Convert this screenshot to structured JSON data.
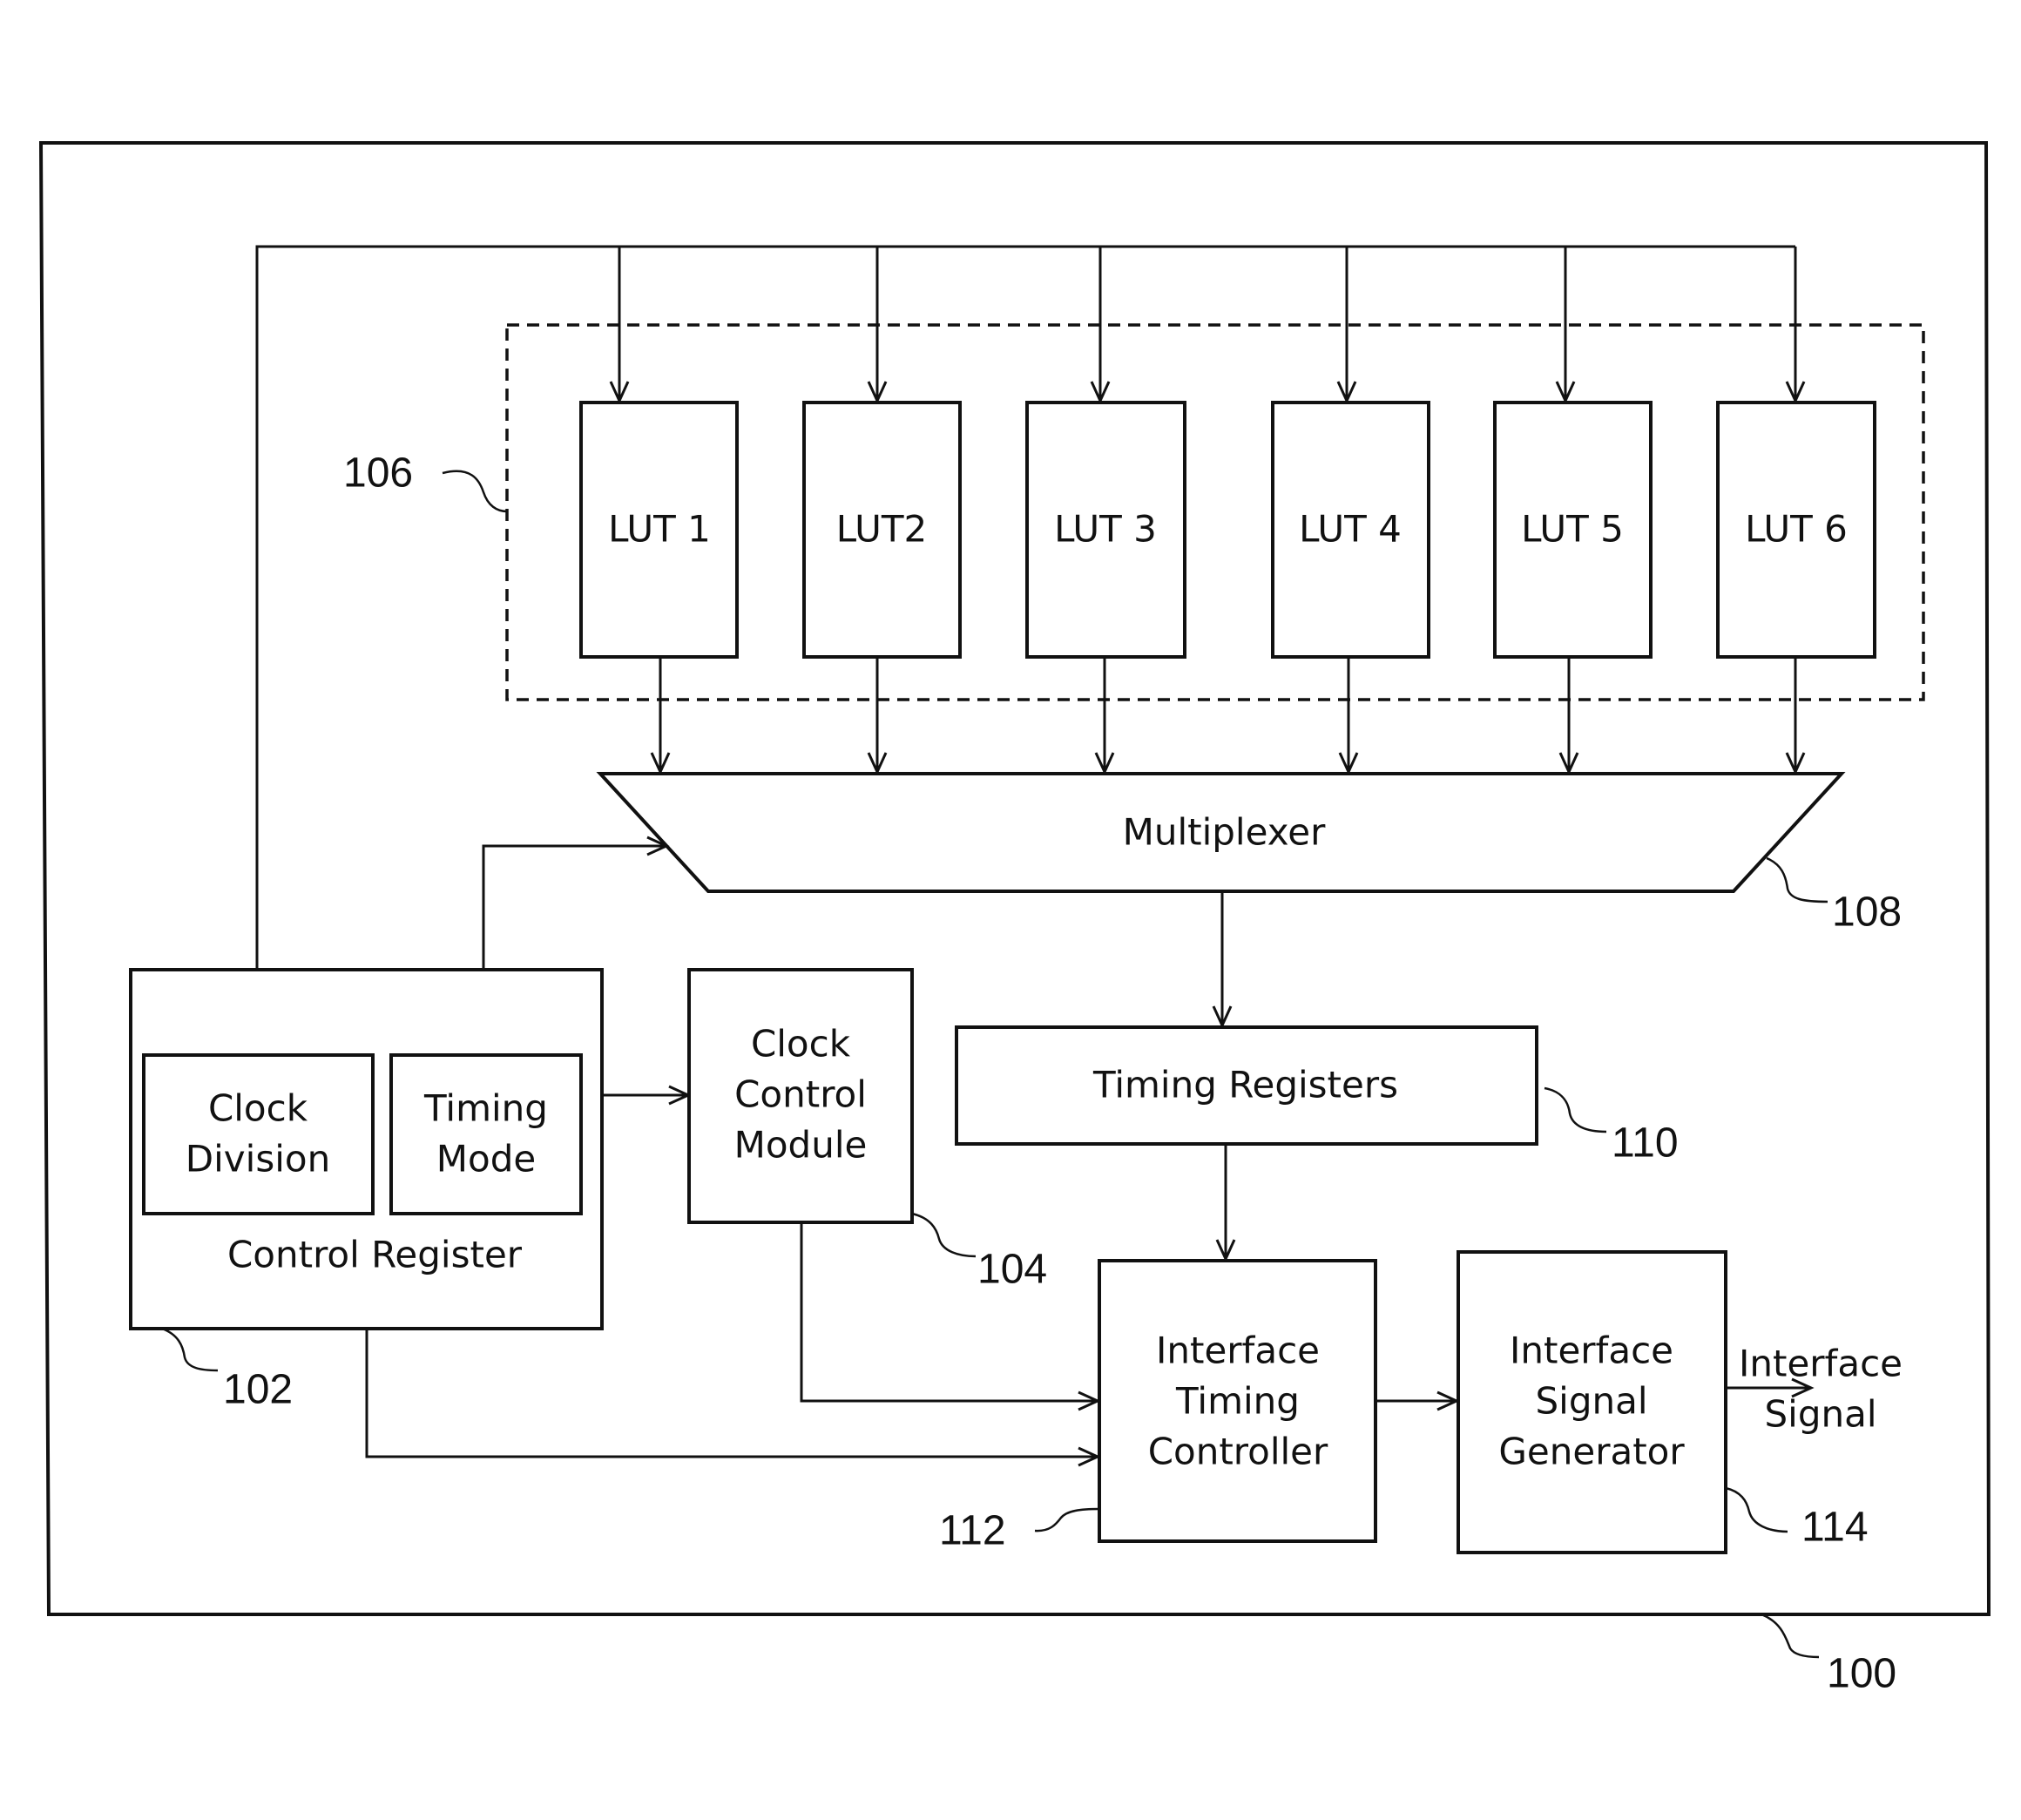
{
  "figure": {
    "outer_ref": "100",
    "control_register": {
      "label": "Control Register",
      "ref": "102",
      "clock_division": [
        "Clock",
        "Division"
      ],
      "timing_mode": [
        "Timing",
        "Mode"
      ]
    },
    "clock_control_module": {
      "lines": [
        "Clock",
        "Control",
        "Module"
      ],
      "ref": "104"
    },
    "lut_group": {
      "ref": "106",
      "luts": [
        "LUT 1",
        "LUT2",
        "LUT 3",
        "LUT 4",
        "LUT 5",
        "LUT 6"
      ]
    },
    "multiplexer": {
      "label": "Multiplexer",
      "ref": "108"
    },
    "timing_registers": {
      "label": "Timing Registers",
      "ref": "110"
    },
    "interface_timing_controller": {
      "lines": [
        "Interface",
        "Timing",
        "Controller"
      ],
      "ref": "112"
    },
    "interface_signal_generator": {
      "lines": [
        "Interface",
        "Signal",
        "Generator"
      ],
      "ref": "114"
    },
    "output": {
      "lines": [
        "Interface",
        "Signal"
      ]
    }
  }
}
